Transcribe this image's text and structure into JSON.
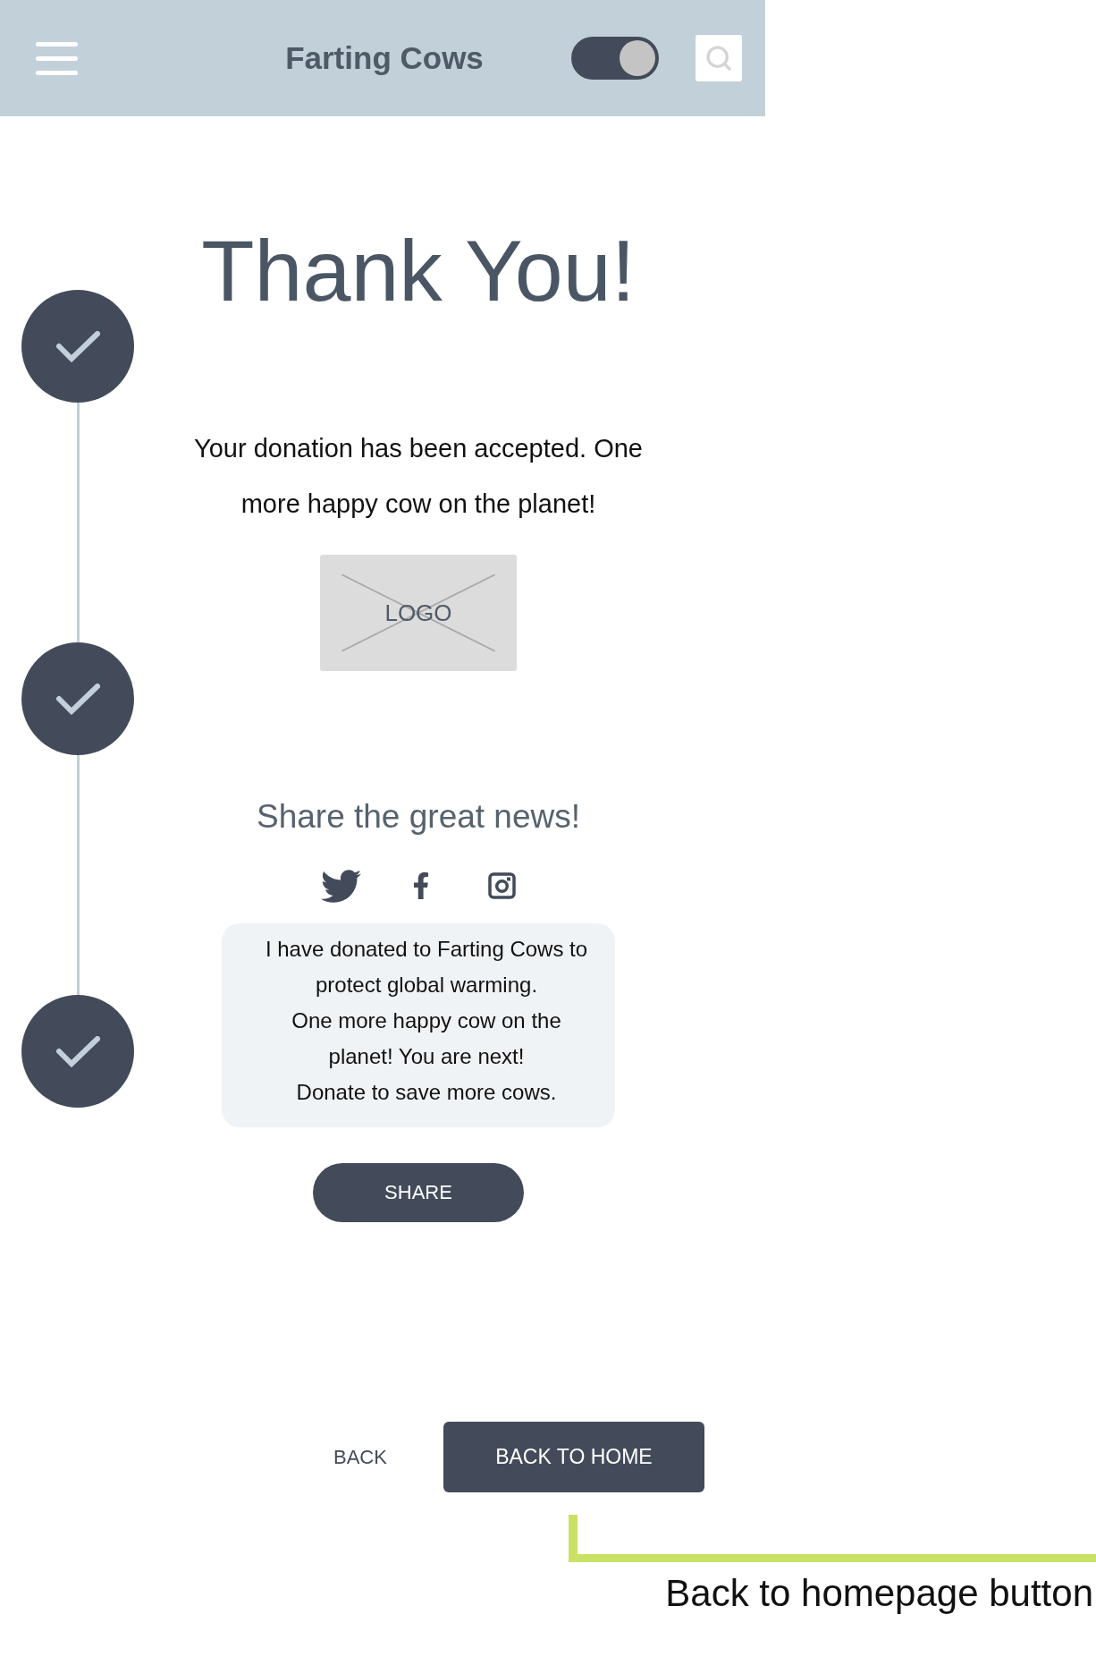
{
  "header": {
    "title": "Farting Cows",
    "toggle": {
      "on": true
    }
  },
  "heading": "Thank You!",
  "steps": [
    {
      "completed": true
    },
    {
      "completed": true
    },
    {
      "completed": true
    }
  ],
  "message": "Your donation has been accepted. One more happy cow on the planet!",
  "logo_placeholder": "LOGO",
  "share": {
    "heading": "Share the great news!",
    "networks": [
      {
        "kind": "bird"
      },
      {
        "kind": "letter_f"
      },
      {
        "kind": "camera"
      }
    ],
    "message_lines": [
      "I have donated to Farting Cows to",
      "protect global warming.",
      "One more happy cow on the",
      "planet! You are next!",
      "Donate to save more cows."
    ],
    "button": "SHARE"
  },
  "actions": {
    "back": "BACK",
    "home": "BACK TO HOME"
  },
  "annotation": "Back to homepage button"
}
